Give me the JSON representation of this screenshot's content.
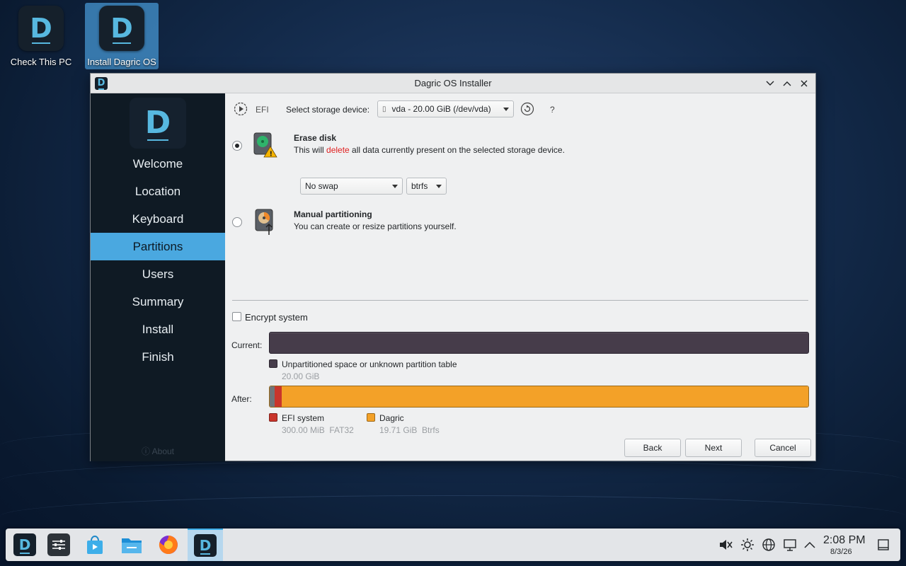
{
  "desktop": {
    "icons": [
      {
        "label": "Check This PC"
      },
      {
        "label": "Install Dagric OS"
      }
    ]
  },
  "window": {
    "title": "Dagric OS Installer",
    "logo_letter": "D"
  },
  "sidebar": {
    "items": [
      {
        "label": "Welcome"
      },
      {
        "label": "Location"
      },
      {
        "label": "Keyboard"
      },
      {
        "label": "Partitions"
      },
      {
        "label": "Users"
      },
      {
        "label": "Summary"
      },
      {
        "label": "Install"
      },
      {
        "label": "Finish"
      }
    ],
    "active_index": 3,
    "about_label": "ⓘ About"
  },
  "partitions": {
    "boot_mode_label": "EFI",
    "storage_label": "Select storage device:",
    "storage_selected": "vda - 20.00 GiB (/dev/vda)",
    "help_label": "?",
    "erase": {
      "title": "Erase disk",
      "desc_before": "This will ",
      "desc_highlight": "delete",
      "desc_after": " all data currently present on the selected storage device.",
      "selected": true
    },
    "swap_selected": "No swap",
    "fs_selected": "btrfs",
    "manual": {
      "title": "Manual partitioning",
      "desc": "You can create or resize partitions yourself.",
      "selected": false
    },
    "encrypt_label": "Encrypt system",
    "encrypt_checked": false,
    "current": {
      "label": "Current:",
      "legend": [
        {
          "name": "Unpartitioned space or unknown partition table",
          "size": "20.00 GiB",
          "color": "#463c4a"
        }
      ]
    },
    "after": {
      "label": "After:",
      "legend": [
        {
          "name": "EFI system",
          "size": "300.00 MiB  FAT32",
          "color": "#c9352b"
        },
        {
          "name": "Dagric",
          "size": "19.71 GiB  Btrfs",
          "color": "#f3a128"
        }
      ],
      "segments": [
        {
          "fraction": 0.009,
          "color": "#707478"
        },
        {
          "fraction": 0.014,
          "color": "#c9352b"
        },
        {
          "fraction": 0.977,
          "color": "#f3a128"
        }
      ]
    },
    "buttons": {
      "back": "Back",
      "next": "Next",
      "cancel": "Cancel"
    }
  },
  "taskbar": {
    "time": "2:08 PM",
    "date": "8/3/26"
  },
  "colors": {
    "accent": "#4aa8e0",
    "sidebar_bg": "#0f1a24",
    "delete_red": "#e02020"
  }
}
